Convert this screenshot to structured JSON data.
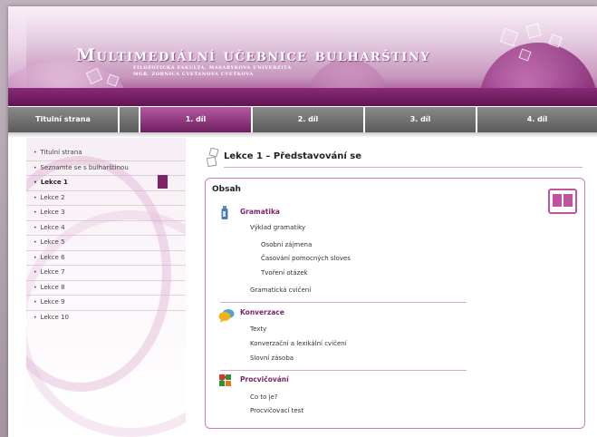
{
  "header": {
    "title": "Multimediální učebnice bulharštiny",
    "subtitle_line1": "Filozofická fakulta, Masarykova univerzita",
    "subtitle_line2": "Mgr. Zornica Cvetanova Cvetkova"
  },
  "nav": {
    "tabs": [
      {
        "label": "Titulní strana"
      },
      {
        "label": "1. díl"
      },
      {
        "label": "2. díl"
      },
      {
        "label": "3. díl"
      },
      {
        "label": "4. díl"
      }
    ],
    "active_index": 1
  },
  "sidebar": {
    "items": [
      {
        "label": "Titulní strana"
      },
      {
        "label": "Seznamte se s bulharštinou"
      },
      {
        "label": "Lekce 1"
      },
      {
        "label": "Lekce 2"
      },
      {
        "label": "Lekce 3"
      },
      {
        "label": "Lekce 4"
      },
      {
        "label": "Lekce 5"
      },
      {
        "label": "Lekce 6"
      },
      {
        "label": "Lekce 7"
      },
      {
        "label": "Lekce 8"
      },
      {
        "label": "Lekce 9"
      },
      {
        "label": "Lekce 10"
      }
    ],
    "active_index": 2,
    "bullet": "•"
  },
  "main": {
    "lesson_title": "Lekce 1 – Představování se",
    "box_title": "Obsah",
    "sections": {
      "gramatika": {
        "title": "Gramatika",
        "link_vyklad": "Výklad gramatiky",
        "link_zajmena": "Osobní zájmena",
        "link_casovani": "Časování pomocných sloves",
        "link_tvoreni": "Tvoření otázek",
        "link_cviceni": "Gramatická cvičení"
      },
      "konverzace": {
        "title": "Konverzace",
        "link_texty": "Texty",
        "link_cviceni": "Konverzační a lexikální cvičení",
        "link_zasoba": "Slovní zásoba"
      },
      "procvicovani": {
        "title": "Procvičování",
        "link_coto": "Co to je?",
        "link_test": "Procvičovací test"
      }
    }
  },
  "colors": {
    "accent": "#7b2468",
    "tab_active": "#8a2a78",
    "tab_inactive": "#6a6a6a",
    "box_border": "#d27ab9"
  }
}
